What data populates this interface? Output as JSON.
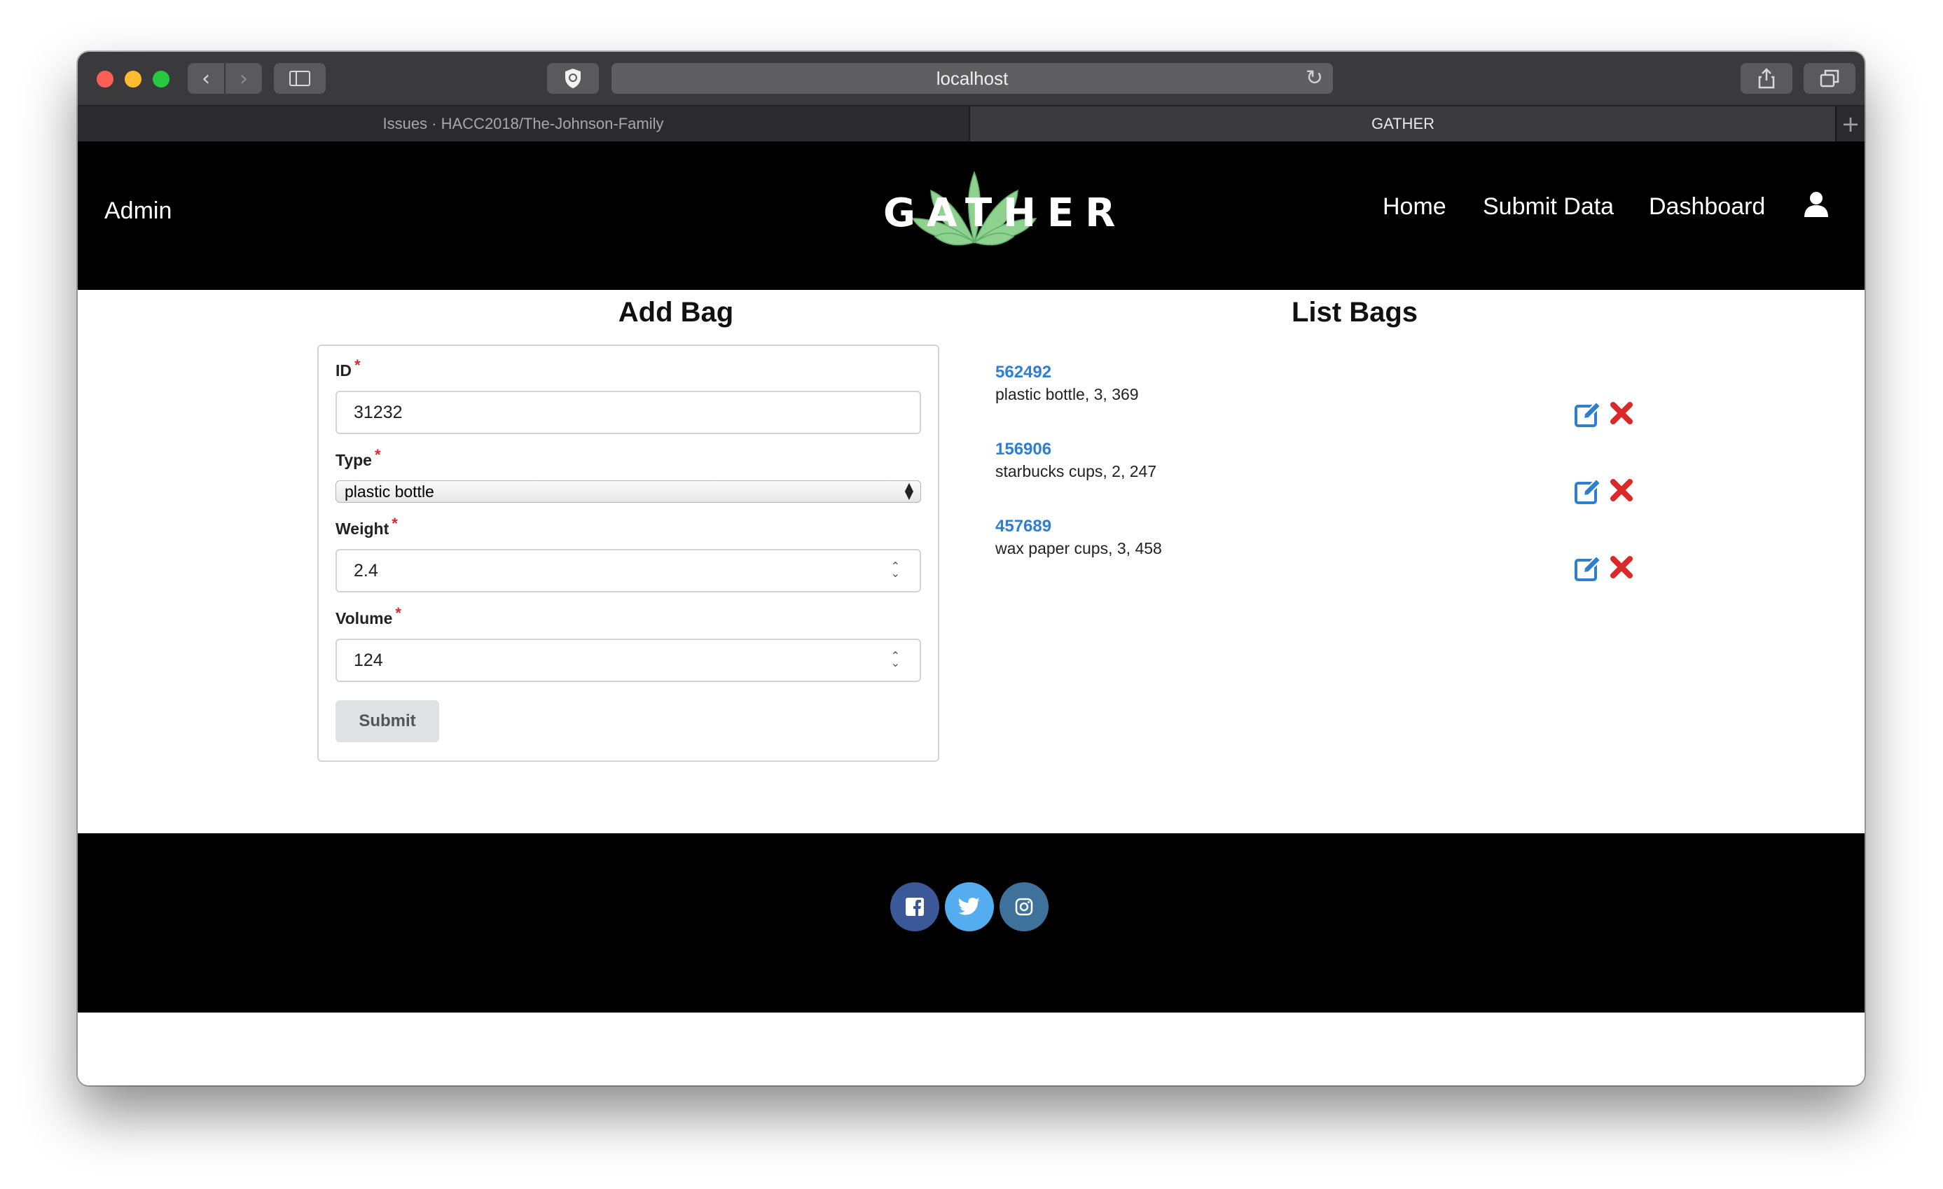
{
  "browser": {
    "url": "localhost",
    "tabs": [
      {
        "label": "Issues · HACC2018/The-Johnson-Family"
      },
      {
        "label": "GATHER"
      }
    ]
  },
  "header": {
    "admin_label": "Admin",
    "logo_text": "GATHER",
    "nav": {
      "home": "Home",
      "submit_data": "Submit Data",
      "dashboard": "Dashboard"
    }
  },
  "add_bag": {
    "title": "Add Bag",
    "fields": {
      "id": {
        "label": "ID",
        "value": "31232"
      },
      "type": {
        "label": "Type",
        "value": "plastic bottle"
      },
      "weight": {
        "label": "Weight",
        "value": "2.4"
      },
      "volume": {
        "label": "Volume",
        "value": "124"
      }
    },
    "required_mark": "*",
    "submit_label": "Submit"
  },
  "list_bags": {
    "title": "List Bags",
    "items": [
      {
        "id": "562492",
        "description": "plastic bottle, 3, 369"
      },
      {
        "id": "156906",
        "description": "starbucks cups, 2, 247"
      },
      {
        "id": "457689",
        "description": "wax paper cups, 3, 458"
      }
    ]
  },
  "colors": {
    "link": "#2e7fcf",
    "delete": "#db2828",
    "facebook": "#3b5998",
    "twitter": "#55acee",
    "instagram": "#3f729b",
    "logo_green": "#8fd18f"
  },
  "icons": {
    "edit": "edit-icon",
    "delete": "close-icon",
    "user": "user-icon",
    "facebook": "facebook-icon",
    "twitter": "twitter-icon",
    "instagram": "instagram-icon"
  }
}
